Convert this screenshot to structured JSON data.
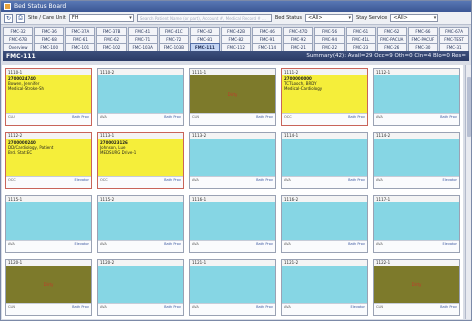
{
  "window": {
    "title": "Bed Status Board"
  },
  "toolbar": {
    "site_label": "Site / Care Unit",
    "site_value": "FH",
    "search_placeholder": "Search Patient Name (or part), Account #, Medical Record # ...",
    "bed_status_label": "Bed Status",
    "bed_status_value": "<All>",
    "stay_service_label": "Stay Service",
    "stay_service_value": "<All>"
  },
  "tabs_row1": [
    "FMC-32",
    "FMC-36",
    "FMC-37A",
    "FMC-37B",
    "FMC-41",
    "FMC-41C",
    "FMC-42",
    "FMC-42B",
    "FMC-46",
    "FMC-47D",
    "FMC-56",
    "FMC-61",
    "FMC-62",
    "FMC-66",
    "FMC-67A"
  ],
  "tabs_row2": [
    "FMC-67B",
    "FMC-68",
    "FMC-61",
    "FMC-62",
    "FMC-71",
    "FMC-72",
    "FMC-81",
    "FMC-82",
    "FMC-91",
    "FMC-92",
    "FMC-94",
    "FMC-41L",
    "FMC-PACUA",
    "FMC-PACUF",
    "FMC-TEST"
  ],
  "tabs_row3": [
    "Overview",
    "FMC-100",
    "FMC-101",
    "FMC-102",
    "FMC-103A",
    "FMC-103B",
    "FMC-111",
    "FMC-112",
    "FMC-114",
    "FMC-21",
    "FMC-22",
    "FMC-23",
    "FMC-26",
    "FMC-30",
    "FMC-31"
  ],
  "active_tab": "FMC-111",
  "header": {
    "unit": "FMC-111",
    "summary": "Summary(42): Avail=29  Occ=9  Oth=0  Cln=4  Blo=0  Res="
  },
  "beds": [
    {
      "id": "1110-1",
      "status": "occupied",
      "lines": [
        "2700024740",
        "Bowen, Jennifer",
        "Medical-Stroke-Sh"
      ],
      "foot": "CLU",
      "foot2": "Bath Prov"
    },
    {
      "id": "1110-2",
      "status": "empty",
      "lines": [],
      "foot": "AVA",
      "foot2": "Bath Prov"
    },
    {
      "id": "1111-1",
      "status": "dirty",
      "lines": [],
      "foot": "CLN",
      "foot2": "Bath Prov"
    },
    {
      "id": "1111-2",
      "status": "occupied",
      "lines": [
        "2700000000",
        "TCTLooch, BRDY",
        "Medical-Cardiology"
      ],
      "foot": "OCC",
      "foot2": "Bath Prov"
    },
    {
      "id": "1112-1",
      "status": "empty",
      "lines": [],
      "foot": "AVA",
      "foot2": "Bath Prov"
    },
    {
      "id": "1112-2",
      "status": "occupied",
      "lines": [
        "2700000240",
        "DD/Cardiology, Patient",
        "Brd. Stat:EC"
      ],
      "foot": "OCC",
      "foot2": "Elevator"
    },
    {
      "id": "1113-1",
      "status": "occupied",
      "lines": [
        "2700023126",
        "Johnson, Lue",
        "MEDSURG Drive-1"
      ],
      "foot": "OCC",
      "foot2": "Bath Prov"
    },
    {
      "id": "1113-2",
      "status": "empty",
      "lines": [],
      "foot": "AVA",
      "foot2": "Bath Prov"
    },
    {
      "id": "1114-1",
      "status": "empty",
      "lines": [],
      "foot": "AVA",
      "foot2": "Bath Prov"
    },
    {
      "id": "1114-2",
      "status": "empty",
      "lines": [],
      "foot": "AVA",
      "foot2": "Elevator"
    },
    {
      "id": "1115-1",
      "status": "empty",
      "lines": [],
      "foot": "AVA",
      "foot2": "Elevator"
    },
    {
      "id": "1115-2",
      "status": "empty",
      "lines": [],
      "foot": "AVA",
      "foot2": "Bath Prov"
    },
    {
      "id": "1116-1",
      "status": "empty",
      "lines": [],
      "foot": "AVA",
      "foot2": "Bath Prov"
    },
    {
      "id": "1116-2",
      "status": "empty",
      "lines": [],
      "foot": "AVA",
      "foot2": "Bath Prov"
    },
    {
      "id": "1117-1",
      "status": "empty",
      "lines": [],
      "foot": "AVA",
      "foot2": "Elevator"
    },
    {
      "id": "1120-1",
      "status": "dirty",
      "lines": [],
      "foot": "CLN",
      "foot2": "Bath Prov"
    },
    {
      "id": "1120-2",
      "status": "empty",
      "lines": [],
      "foot": "AVA",
      "foot2": "Bath Prov"
    },
    {
      "id": "1121-1",
      "status": "empty",
      "lines": [],
      "foot": "AVA",
      "foot2": "Bath Prov"
    },
    {
      "id": "1121-2",
      "status": "empty",
      "lines": [],
      "foot": "AVA",
      "foot2": "Elevator"
    },
    {
      "id": "1122-1",
      "status": "dirty",
      "lines": [],
      "foot": "CLN",
      "foot2": "Bath Prov"
    }
  ],
  "dirty_label": "Dirty",
  "colors": {
    "empty": "#86d6e4",
    "occupied": "#f5ee3a",
    "dirty": "#7d7a2b",
    "header": "#2a3a65"
  }
}
